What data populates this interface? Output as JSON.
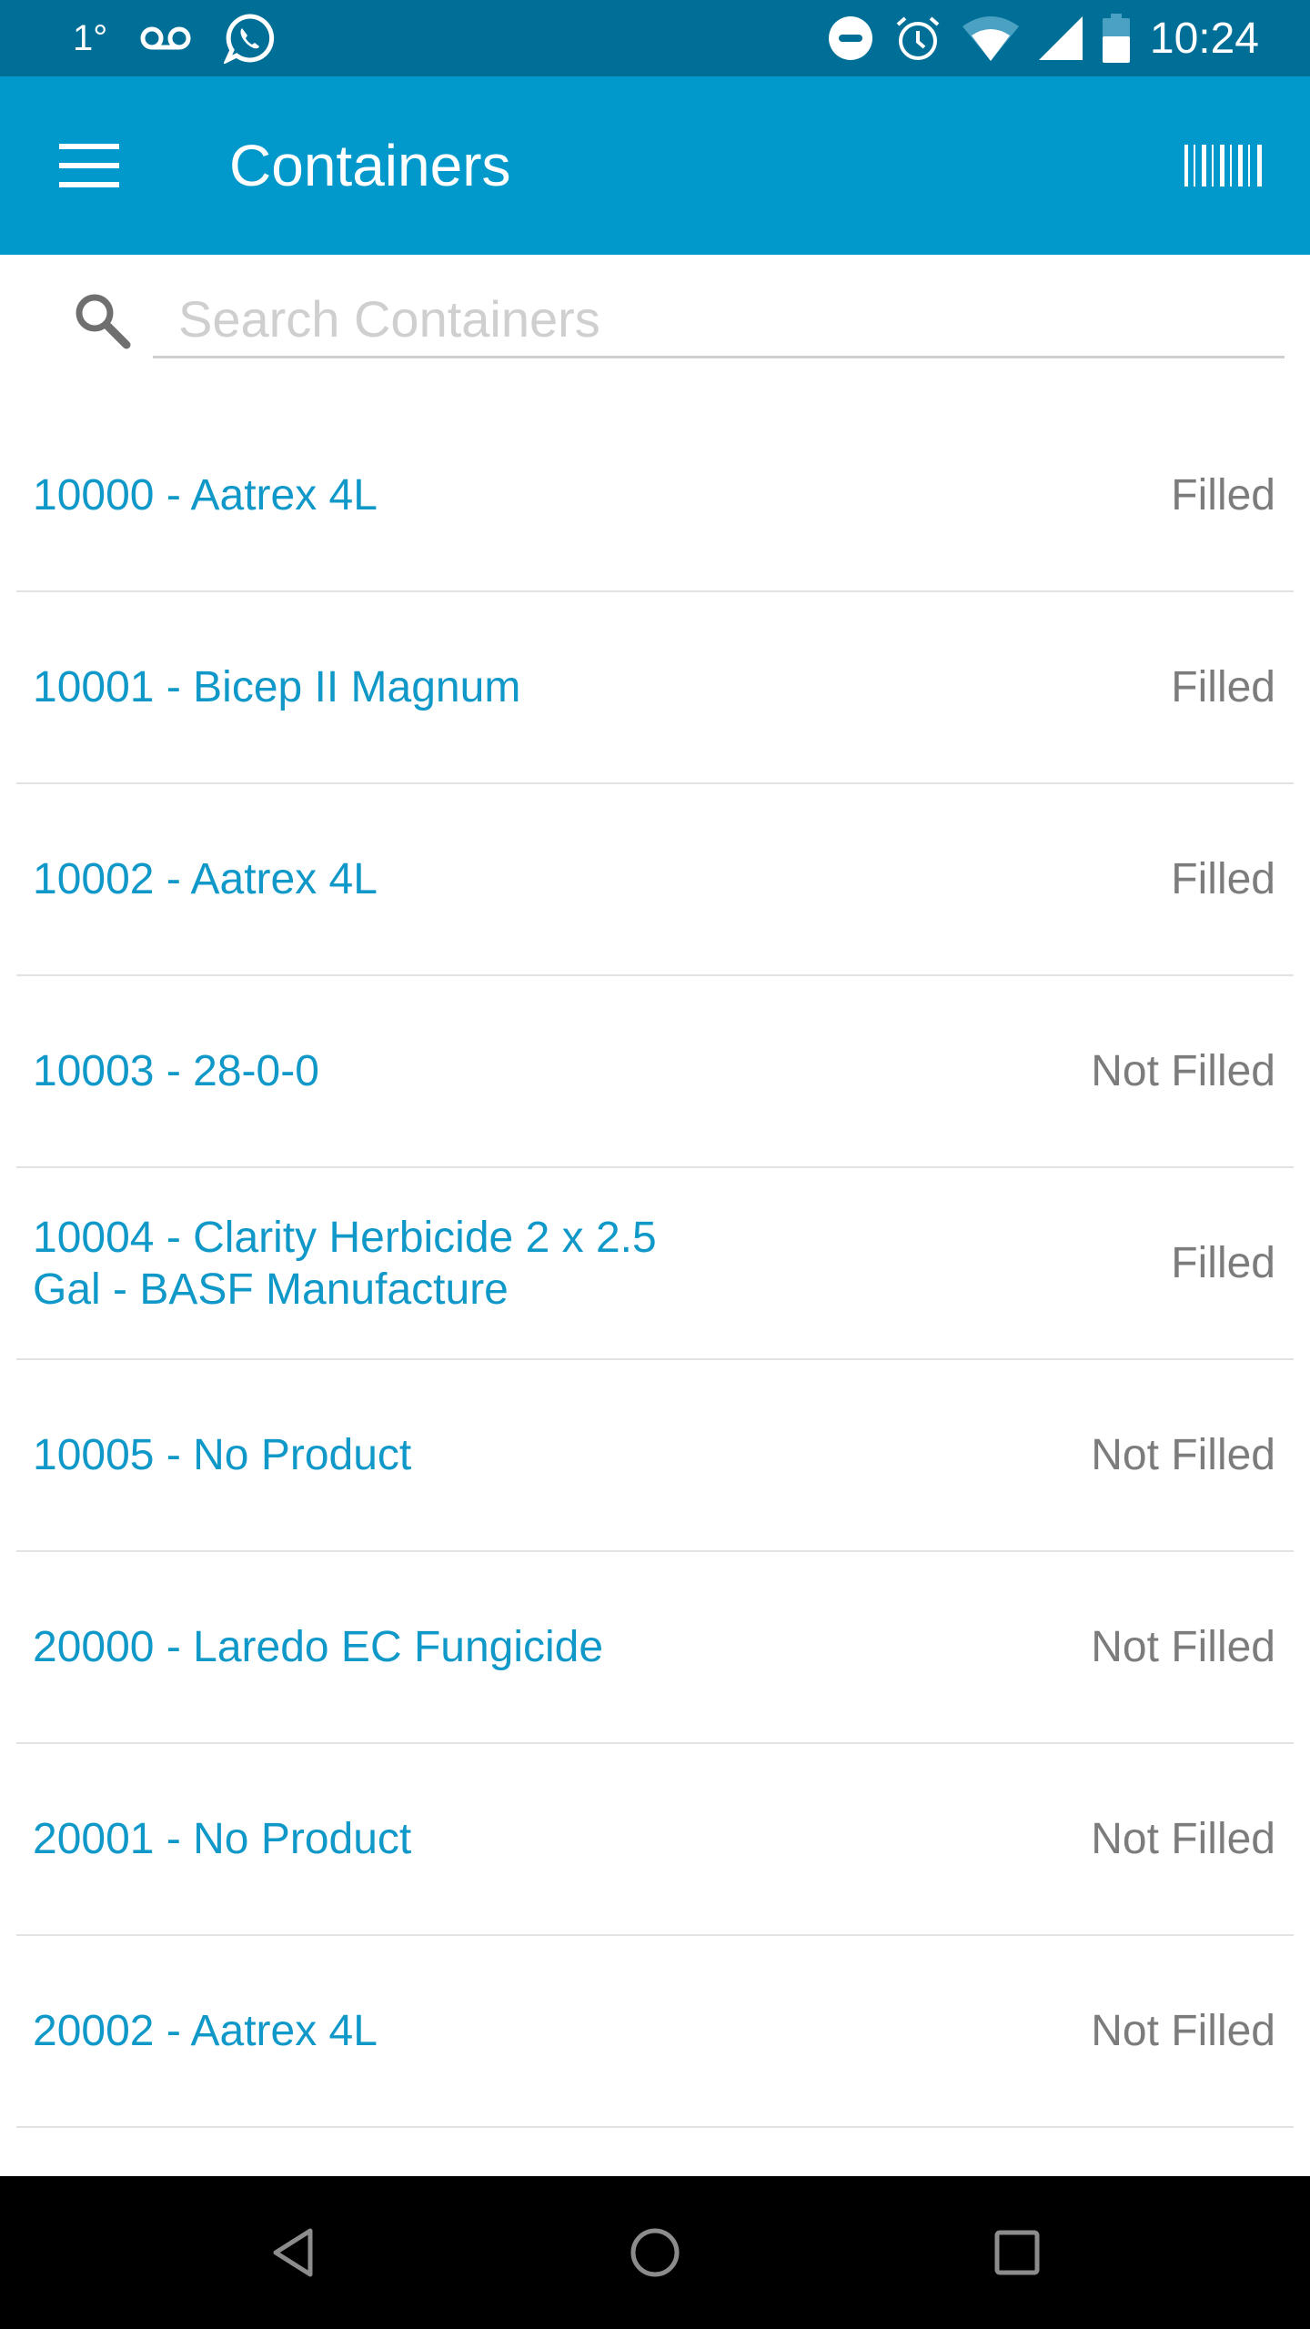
{
  "status_bar": {
    "temperature": "1°",
    "time": "10:24",
    "left_icons": [
      "temperature-text",
      "voicemail-icon",
      "whatsapp-icon"
    ],
    "right_icons": [
      "do-not-disturb-icon",
      "alarm-icon",
      "wifi-icon",
      "cell-signal-icon",
      "battery-icon"
    ],
    "battery_level": 0.6
  },
  "app_bar": {
    "title": "Containers",
    "menu_icon": "hamburger-menu-icon",
    "action_icon": "barcode-scan-icon",
    "background": "#0199cc"
  },
  "search": {
    "placeholder": "Search Containers",
    "value": ""
  },
  "containers": [
    {
      "label": "10000 - Aatrex 4L",
      "status": "Filled"
    },
    {
      "label": "10001 - Bicep II Magnum",
      "status": "Filled"
    },
    {
      "label": "10002 - Aatrex 4L",
      "status": "Filled"
    },
    {
      "label": "10003 - 28-0-0",
      "status": "Not Filled"
    },
    {
      "label": "10004 - Clarity Herbicide 2 x 2.5 Gal - BASF Manufacture",
      "status": "Filled"
    },
    {
      "label": "10005 - No Product",
      "status": "Not Filled"
    },
    {
      "label": "20000 - Laredo EC Fungicide",
      "status": "Not Filled"
    },
    {
      "label": "20001 - No Product",
      "status": "Not Filled"
    },
    {
      "label": "20002 - Aatrex 4L",
      "status": "Not Filled"
    }
  ],
  "colors": {
    "status_bar": "#006f98",
    "accent": "#0199cc",
    "item_text": "#0f98c8",
    "status_text": "#7c7c7c",
    "divider": "#e3e3e3"
  },
  "nav_bar": {
    "buttons": [
      "back-icon",
      "home-icon",
      "recents-icon"
    ]
  }
}
